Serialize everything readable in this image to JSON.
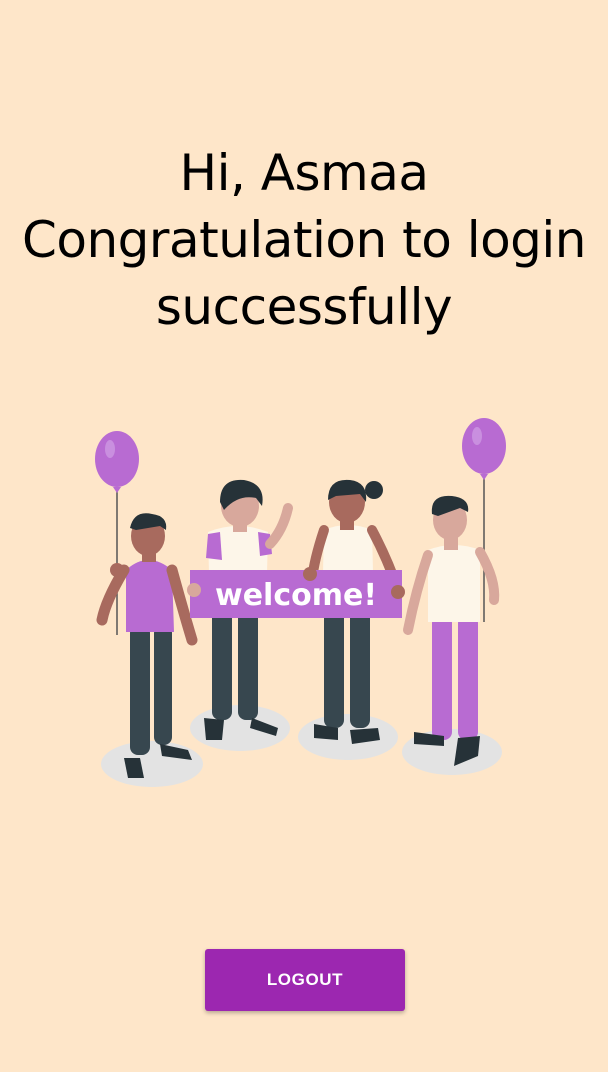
{
  "greeting": {
    "line1": "Hi, Asmaa",
    "line2": "Congratulation to login",
    "line3": "successfully"
  },
  "illustration": {
    "sign_text": "welcome!",
    "colors": {
      "accent": "#b86bd2",
      "skin_dark": "#a86a5e",
      "skin_light": "#d8a89c",
      "pants": "#37474f",
      "shadow": "#e3e3e3"
    }
  },
  "logout_button": {
    "label": "LOGOUT",
    "color": "#9c27b0"
  },
  "background_color": "#fee6c9"
}
